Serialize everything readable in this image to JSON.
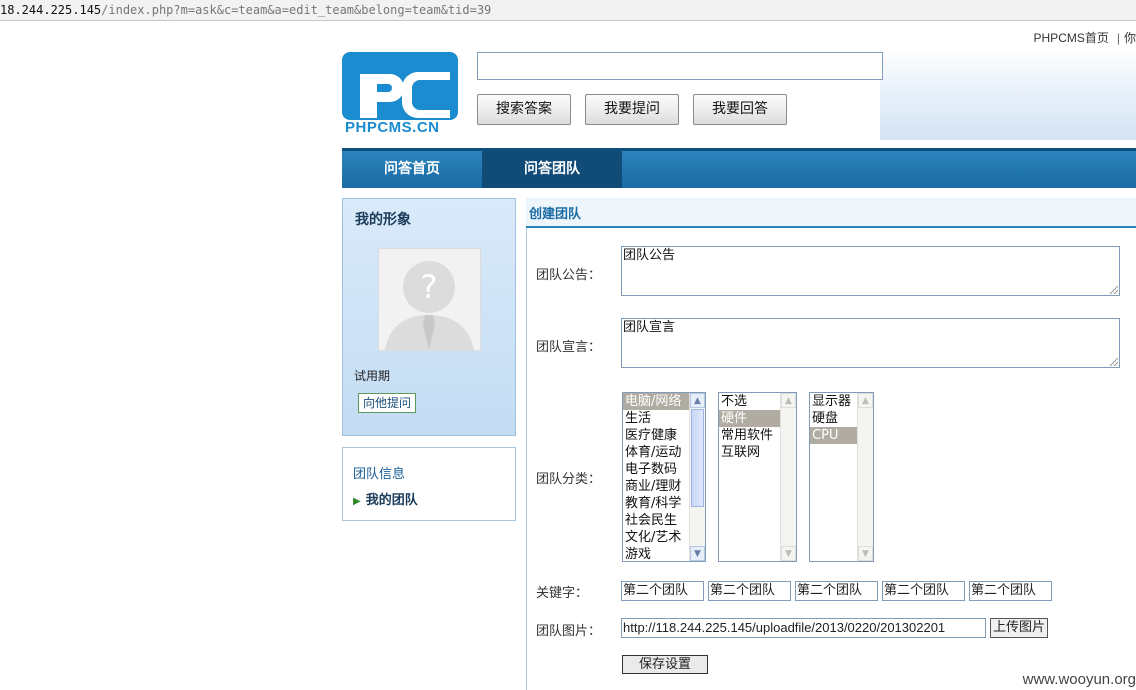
{
  "browser": {
    "url_host": "18.244.225.145",
    "url_path": "/index.php?m=ask&c=team&a=edit_team&belong=team&tid=39"
  },
  "toplinks": {
    "home": "PHPCMS首页",
    "partial": "你"
  },
  "logo": {
    "text": "PHPCMS.CN",
    "letters": "PC",
    "color": "#1a8ccf"
  },
  "search": {
    "value": "",
    "placeholder": ""
  },
  "buttons": {
    "search": "搜索答案",
    "ask": "我要提问",
    "answer": "我要回答"
  },
  "nav": [
    {
      "label": "问答首页",
      "active": false
    },
    {
      "label": "问答团队",
      "active": true
    }
  ],
  "profile": {
    "title": "我的形象",
    "status": "试用期",
    "ask_button": "向他提问"
  },
  "team_menu": {
    "info": "团队信息",
    "mine": "我的团队"
  },
  "form": {
    "title": "创建团队",
    "announcement": {
      "label": "团队公告：",
      "value": "团队公告"
    },
    "manifesto": {
      "label": "团队宣言：",
      "value": "团队宣言"
    },
    "category": {
      "label": "团队分类：",
      "list1": [
        "电脑/网络",
        "生活",
        "医疗健康",
        "体育/运动",
        "电子数码",
        "商业/理财",
        "教育/科学",
        "社会民生",
        "文化/艺术",
        "游戏"
      ],
      "list1_selected": 0,
      "list2": [
        "不选",
        "硬件",
        "常用软件",
        "互联网"
      ],
      "list2_selected": 1,
      "list3": [
        "显示器",
        "硬盘",
        "CPU"
      ],
      "list3_selected": 2
    },
    "keywords": {
      "label": "关键字：",
      "values": [
        "第二个团队",
        "第二个团队",
        "第二个团队",
        "第二个团队",
        "第二个团队"
      ]
    },
    "image": {
      "label": "团队图片：",
      "value": "http://118.244.225.145/uploadfile/2013/0220/201302201",
      "upload_button": "上传图片"
    },
    "save_button": "保存设置"
  },
  "watermark": "www.wooyun.org",
  "colors": {
    "nav": "#1a6ba3",
    "nav_active": "#114c78",
    "accent": "#2b84bd",
    "profile_bg": "#c4dcf3"
  }
}
